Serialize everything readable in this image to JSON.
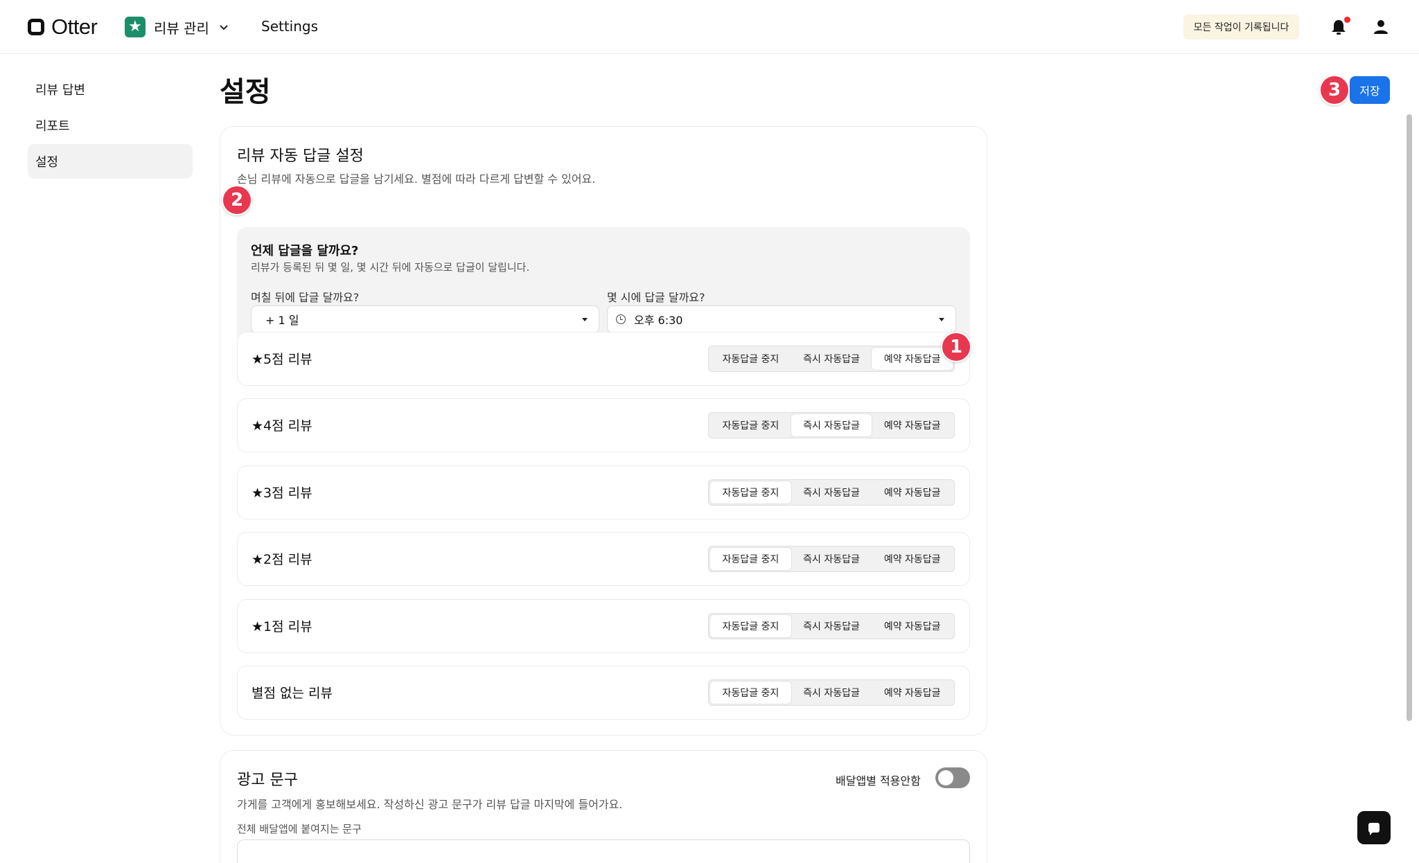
{
  "header": {
    "logo_text": "Otter",
    "app_name": "리뷰 관리",
    "app_icon": "star-icon",
    "nav_settings": "Settings",
    "log_badge": "모든 작업이 기록됩니다",
    "icons": [
      "bell-icon",
      "person-icon"
    ],
    "notification_dot_color": "#ee2b2b"
  },
  "sidebar": {
    "items": [
      {
        "label": "리뷰 답변",
        "active": false
      },
      {
        "label": "리포트",
        "active": false
      },
      {
        "label": "설정",
        "active": true
      }
    ]
  },
  "main": {
    "title": "설정",
    "save_label": "저장",
    "accent_color": "#1a73e8",
    "markers": [
      "1",
      "2",
      "3"
    ],
    "auto_reply": {
      "title": "리뷰 자동 답글 설정",
      "desc": "손님 리뷰에 자동으로 답글을 남기세요. 별점에 따라 다르게 답변할 수 있어요.",
      "when": {
        "title": "언제 답글을 달까요?",
        "desc": "리뷰가 등록된 뒤 몇 일, 몇 시간 뒤에 자동으로 답글이 달립니다.",
        "days_label": "며칠 뒤에 답글 달까요?",
        "days_value": "+ 1 일",
        "time_label": "몇 시에 답글 달까요?",
        "time_value": "오후 6:30"
      },
      "options": [
        "자동답글 중지",
        "즉시 자동답글",
        "예약 자동답글"
      ],
      "rows": [
        {
          "label": "★5점 리뷰",
          "selected": "예약 자동답글"
        },
        {
          "label": "★4점 리뷰",
          "selected": "즉시 자동답글"
        },
        {
          "label": "★3점 리뷰",
          "selected": "자동답글 중지"
        },
        {
          "label": "★2점 리뷰",
          "selected": "자동답글 중지"
        },
        {
          "label": "★1점 리뷰",
          "selected": "자동답글 중지"
        },
        {
          "label": "별점 없는 리뷰",
          "selected": "자동답글 중지"
        }
      ]
    },
    "ad": {
      "title": "광고 문구",
      "desc": "가게를 고객에게 홍보해보세요. 작성하신 광고 문구가 리뷰 답글 마지막에 들어가요.",
      "toggle_label": "배달앱별 적용안함",
      "toggle_on": false,
      "field_label": "전체 배달앱에 붙여지는 문구",
      "field_value": ""
    }
  }
}
